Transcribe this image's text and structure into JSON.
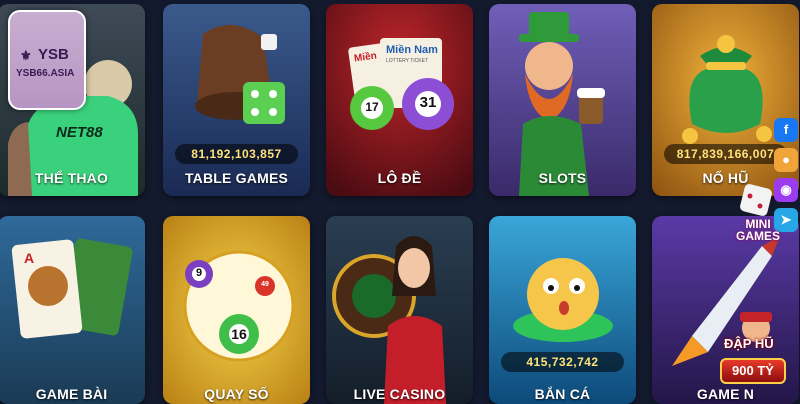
{
  "brand": {
    "logo_mark": "⚜",
    "name": "YSB",
    "url": "YSB66.ASIA"
  },
  "cards": [
    {
      "label": "THỂ THAO",
      "jersey": "NET88"
    },
    {
      "label": "TABLE GAMES",
      "jackpot": "81,192,103,857"
    },
    {
      "label": "LÔ ĐỀ",
      "ticket1": "Miền",
      "ticket2": "Miền Nam",
      "ticket2_sub": "LOTTERY TICKET",
      "ball1": "17",
      "ball2": "31"
    },
    {
      "label": "SLOTS"
    },
    {
      "label": "NỔ HŨ",
      "jackpot": "817,839,166,007"
    },
    {
      "label": "GAME BÀI",
      "card": "A"
    },
    {
      "label": "QUAY SỐ",
      "ball1": "9",
      "ball2": "16",
      "ball3": "49"
    },
    {
      "label": "LIVE CASINO"
    },
    {
      "label": "BẮN CÁ",
      "jackpot": "415,732,742"
    },
    {
      "label": "GAME N"
    }
  ],
  "sidebar": {
    "items": [
      {
        "icon": "facebook-icon",
        "glyph": "f",
        "color": "#1877f2"
      },
      {
        "icon": "zalo-icon",
        "glyph": "●",
        "color": "#f0a43a"
      },
      {
        "icon": "messenger-icon",
        "glyph": "◉",
        "color": "#9b3cf0"
      },
      {
        "icon": "telegram-icon",
        "glyph": "➤",
        "color": "#27a7e7"
      }
    ]
  },
  "mini_games": {
    "line1": "MINI",
    "line2": "GAMES"
  },
  "promo": {
    "line1": "ĐẬP HŨ",
    "line2": "900 TỶ"
  },
  "colors": {
    "background": "#141a2e",
    "jackpot_text": "#ffe27a"
  }
}
